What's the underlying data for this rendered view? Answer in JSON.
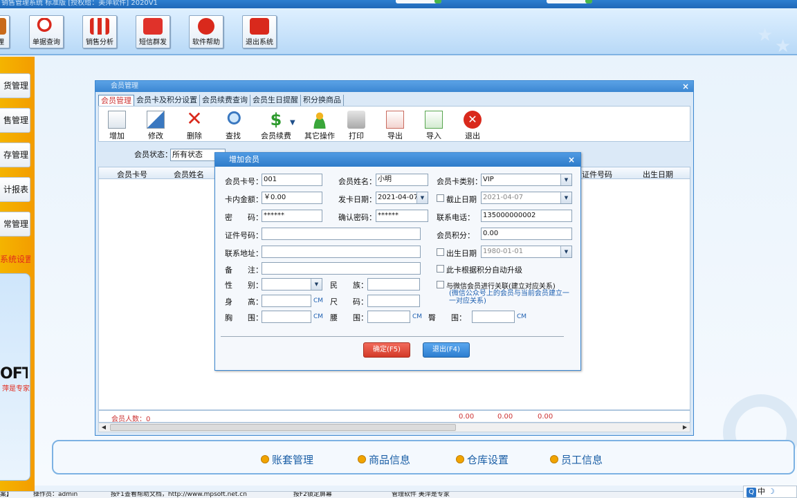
{
  "app": {
    "title": "销售管理系统 标准版 [授权给：美萍软件] 2020V1"
  },
  "toolbar": {
    "items": [
      {
        "label": "理",
        "icon": "manage-icon"
      },
      {
        "label": "单据查询",
        "icon": "magnifier-icon"
      },
      {
        "label": "销售分析",
        "icon": "bar-chart-icon"
      },
      {
        "label": "短信群发",
        "icon": "envelope-icon"
      },
      {
        "label": "软件帮助",
        "icon": "help-icon"
      },
      {
        "label": "退出系统",
        "icon": "power-icon"
      }
    ]
  },
  "sidebar": {
    "items": [
      "货管理",
      "售管理",
      "存管理",
      "计报表",
      "常管理"
    ],
    "system": "系统设置",
    "logo": "OFT",
    "slogan": "萍是专家"
  },
  "member_window": {
    "title": "会员管理",
    "tabs": [
      "会员管理",
      "会员卡及积分设置",
      "会员续费查询",
      "会员生日提醒",
      "积分换商品"
    ],
    "tools": [
      {
        "label": "增加",
        "icon": "add-doc-icon"
      },
      {
        "label": "修改",
        "icon": "edit-icon"
      },
      {
        "label": "删除",
        "icon": "delete-icon"
      },
      {
        "label": "查找",
        "icon": "search-icon"
      },
      {
        "label": "会员续费",
        "icon": "dollar-icon"
      },
      {
        "label": "其它操作",
        "icon": "user-icon"
      },
      {
        "label": "打印",
        "icon": "printer-icon"
      },
      {
        "label": "导出",
        "icon": "export-icon"
      },
      {
        "label": "导入",
        "icon": "import-icon"
      },
      {
        "label": "退出",
        "icon": "exit-icon"
      }
    ],
    "status_label": "会员状态：",
    "status_value": "所有状态",
    "columns": [
      "会员卡号",
      "会员姓名",
      "证件号码",
      "出生日期"
    ],
    "footer_count": "会员人数：0",
    "footer_totals": [
      "0.00",
      "0.00",
      "0.00"
    ]
  },
  "dialog": {
    "title": "增加会员",
    "card_no_label": "会员卡号：",
    "card_no": "001",
    "name_label": "会员姓名：",
    "name": "小明",
    "card_type_label": "会员卡类别：",
    "card_type": "VIP",
    "balance_label": "卡内金额：",
    "balance": "￥0.00",
    "issue_date_label": "发卡日期：",
    "issue_date": "2021-04-07",
    "expire_label": "截止日期",
    "expire_date": "2021-04-07",
    "password_label": "密　　码：",
    "password": "******",
    "confirm_label": "确认密码：",
    "confirm": "******",
    "phone_label": "联系电话：",
    "phone": "135000000002",
    "id_label": "证件号码：",
    "points_label": "会员积分：",
    "points": "0.00",
    "address_label": "联系地址：",
    "birth_label": "出生日期",
    "birth_date": "1980-01-01",
    "remark_label": "备　　注：",
    "auto_upgrade_label": "此卡根据积分自动升级",
    "gender_label": "性　　别：",
    "nation_label": "民　　族：",
    "wechat_label": "与微信会员进行关联(建立对应关系)",
    "wechat_note": "(微信公众号上的会员与当前会员建立一一对应关系)",
    "height_label": "身　　高：",
    "size_label": "尺　　码：",
    "chest_label": "胸　　围：",
    "waist_label": "腰　　围：",
    "hip_label": "臀　　围：",
    "unit": "CM",
    "ok": "确定(F5)",
    "exit": "退出(F4)"
  },
  "bottom_nav": [
    "账套管理",
    "商品信息",
    "仓库设置",
    "员工信息"
  ],
  "statusbar": [
    "案】",
    "操作员：admin",
    "按F1查看帮助文档，http://www.mpsoft.net.cn",
    "按F2锁定屏幕",
    "管理软件 美萍是专家"
  ],
  "ime": "中"
}
